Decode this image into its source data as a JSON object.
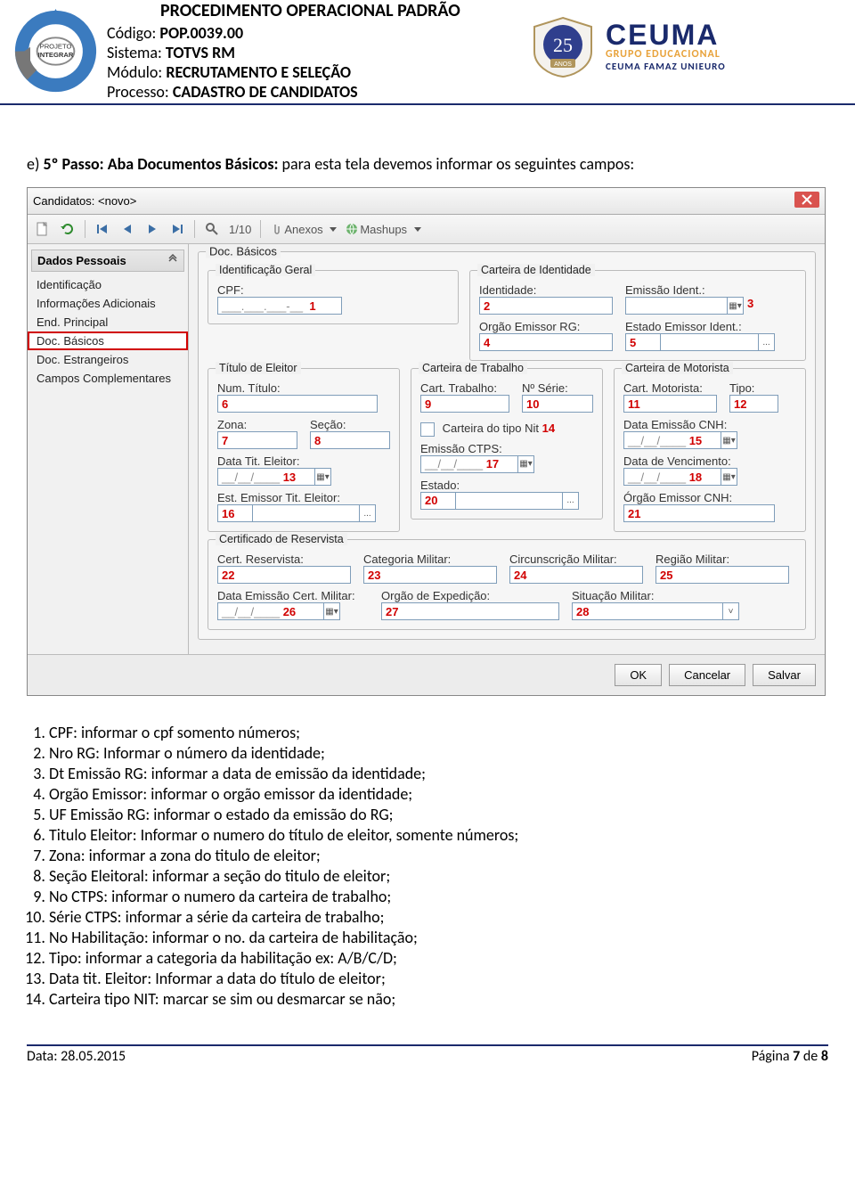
{
  "header": {
    "pop_title": "PROCEDIMENTO OPERACIONAL PADRÃO",
    "meta": {
      "codigo_lbl": "Código: ",
      "codigo_val": "POP.0039.00",
      "sistema_lbl": "Sistema: ",
      "sistema_val": "TOTVS RM",
      "modulo_lbl": "Módulo: ",
      "modulo_val": "RECRUTAMENTO E SELEÇÃO",
      "processo_lbl": "Processo: ",
      "processo_val": "CADASTRO DE CANDIDATOS"
    },
    "logos": {
      "integrar_text_top": "PROJETO",
      "integrar_text_bot": "INTEGRAR",
      "anos25": "25",
      "anos_label": "ANOS",
      "ceuma_top": "CEUMA",
      "ceuma_mid": "GRUPO EDUCACIONAL",
      "ceuma_bot": "CEUMA FAMAZ UNIEURO"
    }
  },
  "step": {
    "intro_e": "e)",
    "intro1": "5º Passo: Aba Documentos Básicos:",
    "intro2": "  para esta tela devemos informar os seguintes campos:"
  },
  "app": {
    "title": "Candidatos: <novo>",
    "toolbar": {
      "counter": "1/10",
      "anexos": "Anexos",
      "mashups": "Mashups"
    },
    "sidebar": {
      "header": "Dados Pessoais",
      "items": [
        "Identificação",
        "Informações Adicionais",
        "End. Principal",
        "Doc. Básicos",
        "Doc. Estrangeiros",
        "Campos Complementares"
      ]
    },
    "form": {
      "grp_docbasicos": "Doc. Básicos",
      "grp_ident_geral": "Identificação Geral",
      "lbl_cpf": "CPF:",
      "val_cpf_mask": "___.___.___-__",
      "n1": "1",
      "grp_cart_ident": "Carteira de Identidade",
      "lbl_identidade": "Identidade:",
      "n2": "2",
      "lbl_emissao_ident": "Emissão Ident.:",
      "n3": "3",
      "lbl_orgao_rg": "Orgão Emissor RG:",
      "n4": "4",
      "lbl_estado_emissor": "Estado Emissor Ident.:",
      "n5": "5",
      "grp_titulo_eleitor": "Título de Eleitor",
      "lbl_num_titulo": "Num. Título:",
      "n6": "6",
      "lbl_zona": "Zona:",
      "n7": "7",
      "lbl_secao": "Seção:",
      "n8": "8",
      "lbl_data_tit_eleitor": "Data Tit. Eleitor:",
      "n13": "13",
      "lbl_est_emissor_tit": "Est. Emissor Tit. Eleitor:",
      "n16": "16",
      "grp_cart_trab": "Carteira de Trabalho",
      "lbl_cart_trab": "Cart. Trabalho:",
      "n9": "9",
      "lbl_n_serie": "Nº Série:",
      "n10": "10",
      "lbl_cart_nit": "Carteira do tipo Nit",
      "n14": "14",
      "lbl_emissao_ctps": "Emissão CTPS:",
      "n17": "17",
      "lbl_estado": "Estado:",
      "n20": "20",
      "grp_cart_moto": "Carteira de Motorista",
      "lbl_cart_moto": "Cart. Motorista:",
      "n11": "11",
      "lbl_tipo": "Tipo:",
      "n12": "12",
      "lbl_data_emissao_cnh": "Data Emissão CNH:",
      "n15": "15",
      "lbl_data_venc": "Data de Vencimento:",
      "n18": "18",
      "lbl_orgao_cnh": "Órgão Emissor CNH:",
      "n21": "21",
      "grp_reservista": "Certificado de Reservista",
      "lbl_cert_reserv": "Cert. Reservista:",
      "n22": "22",
      "lbl_cat_militar": "Categoria Militar:",
      "n23": "23",
      "lbl_circ_militar": "Circunscrição Militar:",
      "n24": "24",
      "lbl_regiao_militar": "Região Militar:",
      "n25": "25",
      "lbl_data_emissao_cert": "Data Emissão Cert. Militar:",
      "n26": "26",
      "lbl_orgao_exped": "Orgão de Expedição:",
      "n27": "27",
      "lbl_sit_militar": "Situação Militar:",
      "n28": "28",
      "date_mask": "__/__/____"
    },
    "buttons": {
      "ok": "OK",
      "cancelar": "Cancelar",
      "salvar": "Salvar"
    }
  },
  "legend": [
    "CPF: informar o cpf somento números;",
    "Nro RG: Informar o número da identidade;",
    "Dt Emissão RG: informar a data de emissão da identidade;",
    "Orgão Emissor: informar o orgão emissor da identidade;",
    "UF Emissão RG: informar o estado da emissão do RG;",
    "Titulo Eleitor: Informar o numero do título de eleitor, somente números;",
    "Zona: informar a zona do titulo de eleitor;",
    "Seção Eleitoral: informar a seção do titulo de eleitor;",
    "No CTPS: informar o numero da carteira de trabalho;",
    "Série CTPS: informar a série da carteira de trabalho;",
    "No Habilitação: informar o no. da carteira de habilitação;",
    "Tipo: informar a categoria da habilitação ex: A/B/C/D;",
    "Data tit. Eleitor: Informar  a data do título de eleitor;",
    "Carteira tipo NIT: marcar se sim ou desmarcar se não;"
  ],
  "footer": {
    "data_lbl": "Data: ",
    "data_val": "28.05.2015",
    "page_lbl": "Página ",
    "page_n": "7",
    "page_de": " de ",
    "page_total": "8"
  }
}
